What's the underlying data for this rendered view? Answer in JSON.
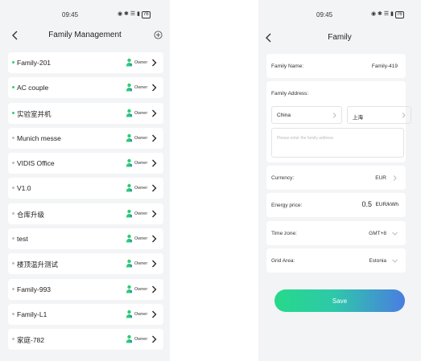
{
  "left_screen": {
    "status": {
      "time": "09:45",
      "icons": "◉ ✱ ☰ ▮",
      "battery": "76"
    },
    "title": "Family Management",
    "families": [
      {
        "name": "Family-201",
        "role": "Owner",
        "active": true
      },
      {
        "name": "AC couple",
        "role": "Owner",
        "active": true
      },
      {
        "name": "实验室并机",
        "role": "Owner",
        "active": true
      },
      {
        "name": "Munich messe",
        "role": "Owner",
        "active": false
      },
      {
        "name": "VIDIS Office",
        "role": "Owner",
        "active": false
      },
      {
        "name": "V1.0",
        "role": "Owner",
        "active": false
      },
      {
        "name": "仓库升级",
        "role": "Owner",
        "active": false
      },
      {
        "name": "test",
        "role": "Owner",
        "active": false
      },
      {
        "name": "楼顶温升测试",
        "role": "Owner",
        "active": false
      },
      {
        "name": "Family-993",
        "role": "Owner",
        "active": false
      },
      {
        "name": "Family-L1",
        "role": "Owner",
        "active": false
      },
      {
        "name": "家庭-782",
        "role": "Owner",
        "active": false
      }
    ]
  },
  "right_screen": {
    "status": {
      "time": "09:45",
      "icons": "◉ ✱ ☰ ▮",
      "battery": "76"
    },
    "title": "Family",
    "family_name": {
      "label": "Family Name:",
      "value": "Family-419"
    },
    "family_address": {
      "label": "Family Address:",
      "country": "China",
      "city": "上海",
      "placeholder": "Please enter the family address"
    },
    "currency": {
      "label": "Currency:",
      "value": "EUR"
    },
    "energy_price": {
      "label": "Energy price:",
      "value": "0.5",
      "unit": "EUR/kWh"
    },
    "time_zone": {
      "label": "Time zone:",
      "value": "GMT+8"
    },
    "grid_area": {
      "label": "Grid Area:",
      "value": "Estonia"
    },
    "save_label": "Save"
  },
  "colors": {
    "active_dot": "#2ecc71",
    "owner_icon": "#2ecc71",
    "save_gradient_start": "#26d98a",
    "save_gradient_end": "#4a7de0",
    "background": "#f3f4f6"
  }
}
